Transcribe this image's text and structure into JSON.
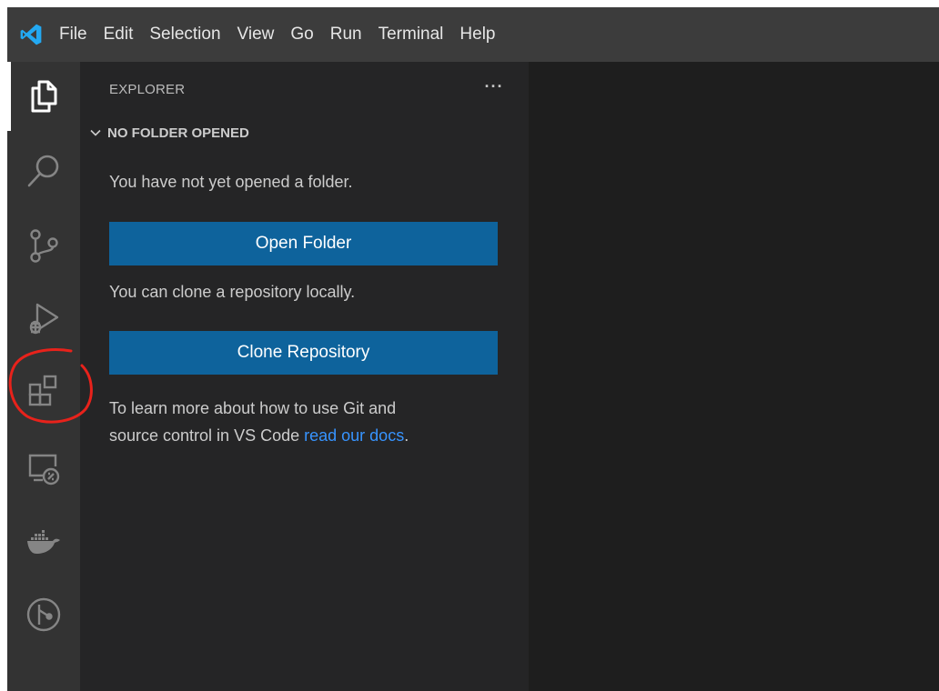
{
  "menu": [
    "File",
    "Edit",
    "Selection",
    "View",
    "Go",
    "Run",
    "Terminal",
    "Help"
  ],
  "activity_bar": [
    {
      "name": "explorer",
      "icon": "files-icon",
      "active": true
    },
    {
      "name": "search",
      "icon": "search-icon",
      "active": false
    },
    {
      "name": "source-control",
      "icon": "source-control-icon",
      "active": false
    },
    {
      "name": "run-debug",
      "icon": "run-debug-icon",
      "active": false
    },
    {
      "name": "extensions",
      "icon": "extensions-icon",
      "active": false
    },
    {
      "name": "remote-explorer",
      "icon": "remote-explorer-icon",
      "active": false
    },
    {
      "name": "docker",
      "icon": "docker-icon",
      "active": false
    },
    {
      "name": "gitlens",
      "icon": "gitlens-icon",
      "active": false
    }
  ],
  "sidebar": {
    "title": "EXPLORER",
    "more": "···",
    "section": "NO FOLDER OPENED",
    "msg_no_folder": "You have not yet opened a folder.",
    "open_folder_label": "Open Folder",
    "msg_clone": "You can clone a repository locally.",
    "clone_label": "Clone Repository",
    "learn_line1": "To learn more about how to use Git and",
    "learn_line2_prefix": "source control in VS Code ",
    "learn_link": "read our docs",
    "learn_suffix": "."
  },
  "colors": {
    "titlebar": "#3c3c3c",
    "activitybar": "#333333",
    "sidebar": "#252526",
    "editor": "#1e1e1e",
    "button": "#0e639c",
    "link": "#3794ff",
    "annotation": "#e8221b",
    "logo": "#23a9f2"
  }
}
